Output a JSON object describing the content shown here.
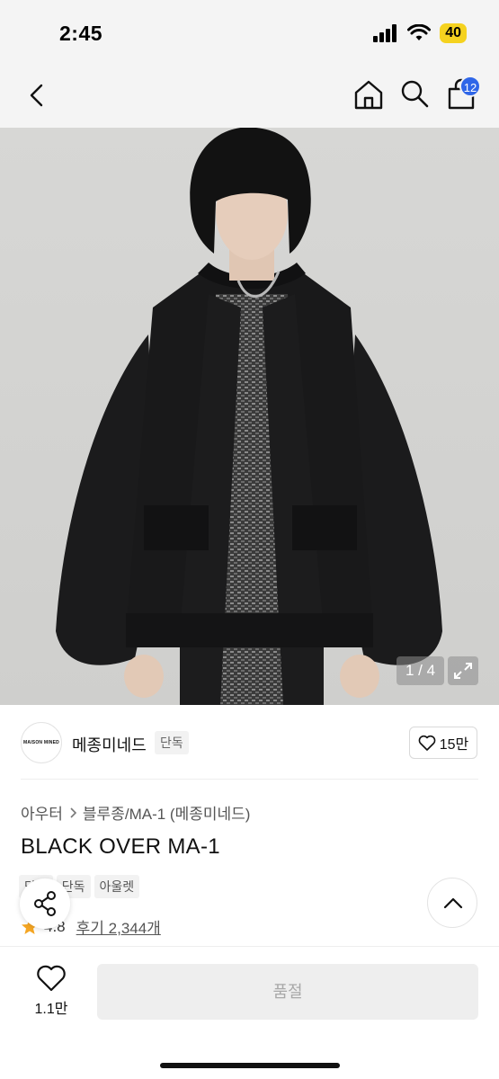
{
  "status": {
    "time": "2:45",
    "battery": "40"
  },
  "nav": {
    "cart_count": "12"
  },
  "gallery": {
    "counter": "1 / 4"
  },
  "brand": {
    "logo_text": "MAISON MINED",
    "name": "메종미네드",
    "tag": "단독",
    "likes": "15만"
  },
  "breadcrumb": {
    "category": "아우터",
    "subcategory": "블루종/MA-1 (메종미네드)"
  },
  "product": {
    "title": "BLACK OVER MA-1",
    "tags": [
      "단독",
      "단독",
      "아울렛"
    ],
    "rating": "4.8",
    "reviews": "후기 2,344개"
  },
  "bottom": {
    "wish_count": "1.1만",
    "buy_label": "품절"
  },
  "colors": {
    "accent": "#2f66e8",
    "star": "#f5a623",
    "battery": "#f5d21f"
  }
}
